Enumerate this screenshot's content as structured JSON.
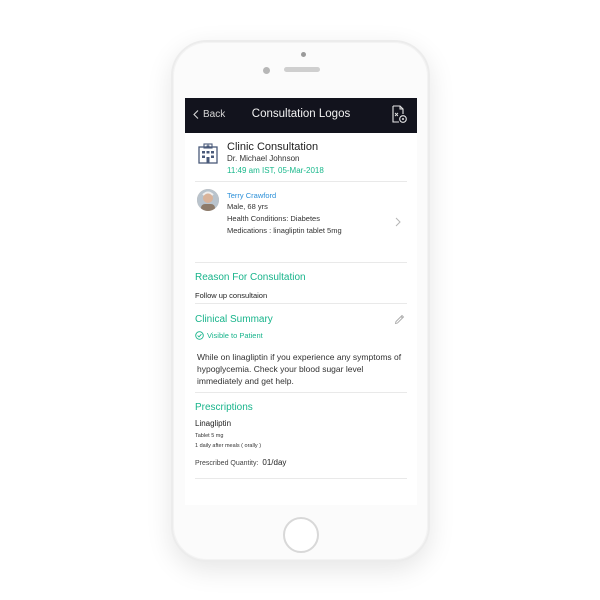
{
  "nav": {
    "back_label": "Back",
    "title": "Consultation Logos"
  },
  "consultation": {
    "title": "Clinic Consultation",
    "doctor": "Dr. Michael Johnson",
    "time": "11:49 am IST, 05-Mar-2018"
  },
  "patient": {
    "name": "Terry Crawford",
    "demographics": "Male, 68 yrs",
    "conditions": "Health Conditions: Diabetes",
    "medications": "Medications : linagliptin tablet 5mg"
  },
  "reason": {
    "heading": "Reason For Consultation",
    "text": "Follow up consultaion"
  },
  "summary": {
    "heading": "Clinical Summary",
    "visibility": "Visible to Patient",
    "text": "While on linagliptin if you experience any symptoms of hypoglycemia. Check your blood sugar level immediately and get help."
  },
  "prescriptions": {
    "heading": "Prescriptions",
    "drug": "Linagliptin",
    "dose": "Tablet 5 mg",
    "instructions": "1 daily after meals ( orally )",
    "quantity_label": "Prescribed Quantity:",
    "quantity_value": "01/day"
  },
  "colors": {
    "topbar": "#12131d",
    "accent_green": "#18b48b",
    "link_blue": "#2a8fd8"
  },
  "icons": [
    "chevron-left-icon",
    "document-settings-icon",
    "clinic-building-icon",
    "chevron-right-icon",
    "pencil-icon",
    "check-circle-icon"
  ]
}
